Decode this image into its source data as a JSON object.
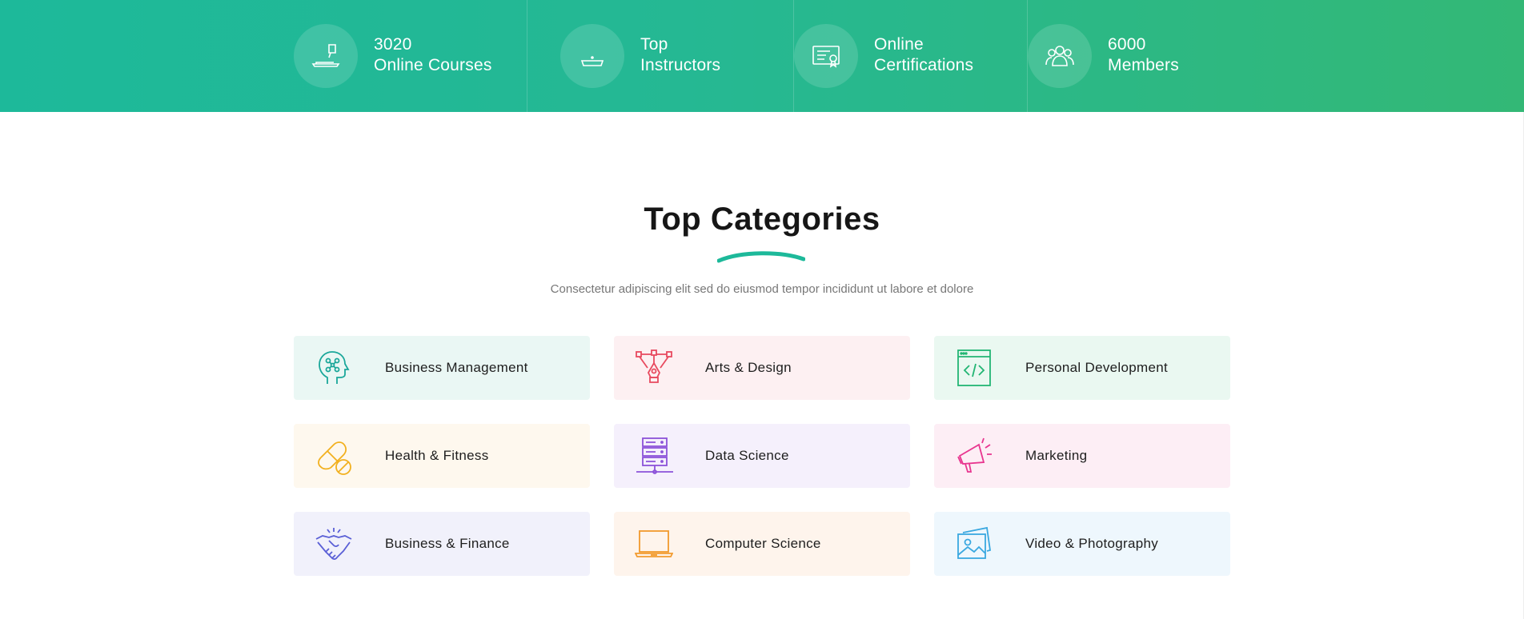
{
  "stats": [
    {
      "line1": "3020",
      "line2": "Online Courses",
      "icon": "laptop-icon"
    },
    {
      "line1": "Top",
      "line2": "Instructors",
      "icon": "teacher-icon"
    },
    {
      "line1": "Online",
      "line2": "Certifications",
      "icon": "certificate-icon"
    },
    {
      "line1": "6000",
      "line2": "Members",
      "icon": "users-icon"
    }
  ],
  "section": {
    "title": "Top Categories",
    "subtitle": "Consectetur adipiscing elit sed do eiusmod tempor incididunt ut labore et dolore"
  },
  "categories": [
    {
      "label": "Business Management",
      "icon": "brain-network-icon",
      "color": "#1aa79a",
      "bg": "#eaf7f4"
    },
    {
      "label": "Arts & Design",
      "icon": "pen-tool-icon",
      "color": "#e84a5f",
      "bg": "#fdf0f2"
    },
    {
      "label": "Personal Development",
      "icon": "code-window-icon",
      "color": "#22b573",
      "bg": "#eaf8f1"
    },
    {
      "label": "Health & Fitness",
      "icon": "pills-icon",
      "color": "#f2b01e",
      "bg": "#fef8ee"
    },
    {
      "label": "Data Science",
      "icon": "server-icon",
      "color": "#8c52d9",
      "bg": "#f5f0fc"
    },
    {
      "label": "Marketing",
      "icon": "megaphone-icon",
      "color": "#e8358f",
      "bg": "#fdeef5"
    },
    {
      "label": "Business & Finance",
      "icon": "handshake-icon",
      "color": "#5a5fd6",
      "bg": "#f1f1fb"
    },
    {
      "label": "Computer Science",
      "icon": "laptop-icon",
      "color": "#f29a2e",
      "bg": "#fef4ec"
    },
    {
      "label": "Video & Photography",
      "icon": "photos-icon",
      "color": "#3aa8e0",
      "bg": "#eef7fd"
    }
  ],
  "colors": {
    "accent": "#1db99a",
    "title": "#161616",
    "subtitle": "#777777"
  }
}
